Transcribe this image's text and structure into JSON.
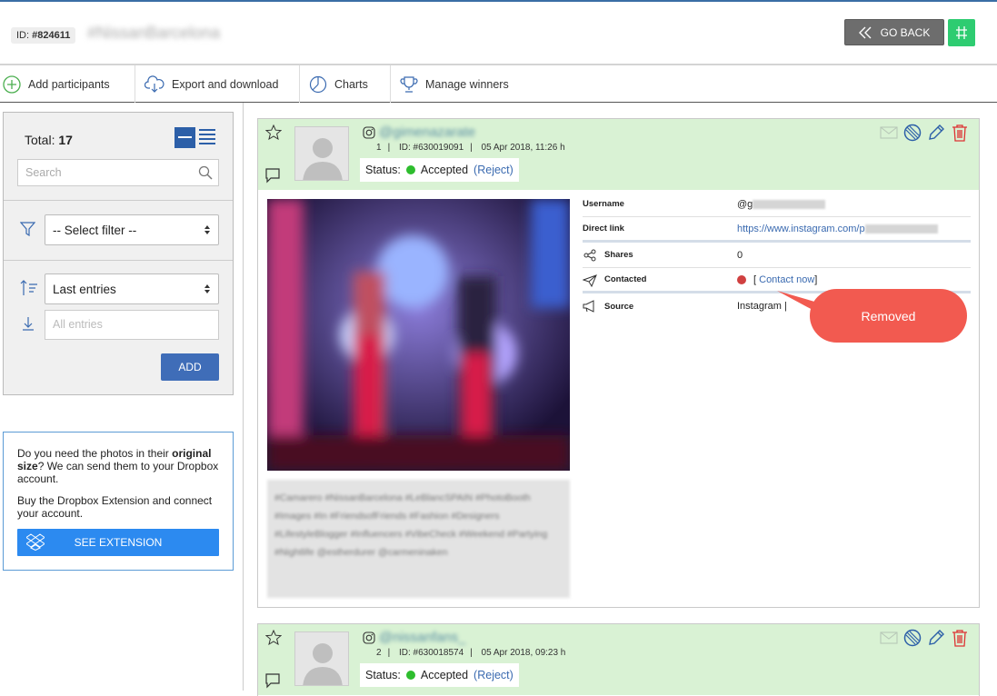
{
  "header": {
    "id_label": "ID:",
    "id_value": "#824611",
    "contest_name": "#NissanBarcelona",
    "go_back_label": "GO BACK",
    "hash_icon": "hashtag-icon"
  },
  "toolbar": {
    "items": [
      {
        "label": "Add participants",
        "icon": "plus-circle-icon"
      },
      {
        "label": "Export and download",
        "icon": "cloud-download-icon"
      },
      {
        "label": "Charts",
        "icon": "pie-chart-icon"
      },
      {
        "label": "Manage winners",
        "icon": "trophy-icon"
      }
    ]
  },
  "sidebar": {
    "total_label": "Total:",
    "total_value": "17",
    "search_placeholder": "Search",
    "filter_value": "-- Select filter --",
    "sort_value": "Last entries",
    "entries_placeholder": "All entries",
    "add_label": "ADD",
    "promo": {
      "line1_pre": "Do you need the photos in their ",
      "line1_bold": "original size",
      "line1_post": "? We can send them to your Dropbox account.",
      "line2": "Buy the Dropbox Extension and connect your account.",
      "button_label": "SEE EXTENSION"
    }
  },
  "entries": [
    {
      "username": "@gimenazarate",
      "index": "1",
      "id": "ID: #630019091",
      "date": "05 Apr 2018, 11:26 h",
      "status_label": "Status:",
      "status_value": "Accepted",
      "reject_label": "(Reject)",
      "details": {
        "username_label": "Username",
        "username_value": "@g",
        "link_label": "Direct link",
        "link_value": "https://www.instagram.com/p",
        "shares_label": "Shares",
        "shares_value": "0",
        "contacted_label": "Contacted",
        "contacted_pre": "[ ",
        "contact_now": "Contact now",
        "contacted_post": "]",
        "source_label": "Source",
        "source_value": "Instagram | "
      },
      "caption": "#Camarero #NissanBarcelona #LeBlancSPAIN #PhotoBooth #Images #In #FriendsofFriends #Fashion #Designers #LifestyleBlogger #Influencers #VibeCheck #Weekend #Partying #Nightlife @estherdurer @carmeninaken"
    },
    {
      "username": "@nissanfans_",
      "index": "2",
      "id": "ID: #630018574",
      "date": "05 Apr 2018, 09:23 h",
      "status_label": "Status:",
      "status_value": "Accepted",
      "reject_label": "(Reject)"
    }
  ],
  "annotation": {
    "label": "Removed",
    "color": "#f25a50"
  },
  "colors": {
    "accent_blue": "#3f6db8",
    "card_header_green": "#d9f2d4",
    "status_green": "#2ebd2e",
    "go_back_gray": "#6d6d6d",
    "hash_green": "#2ecc71",
    "dropbox_blue": "#2c8af0"
  }
}
